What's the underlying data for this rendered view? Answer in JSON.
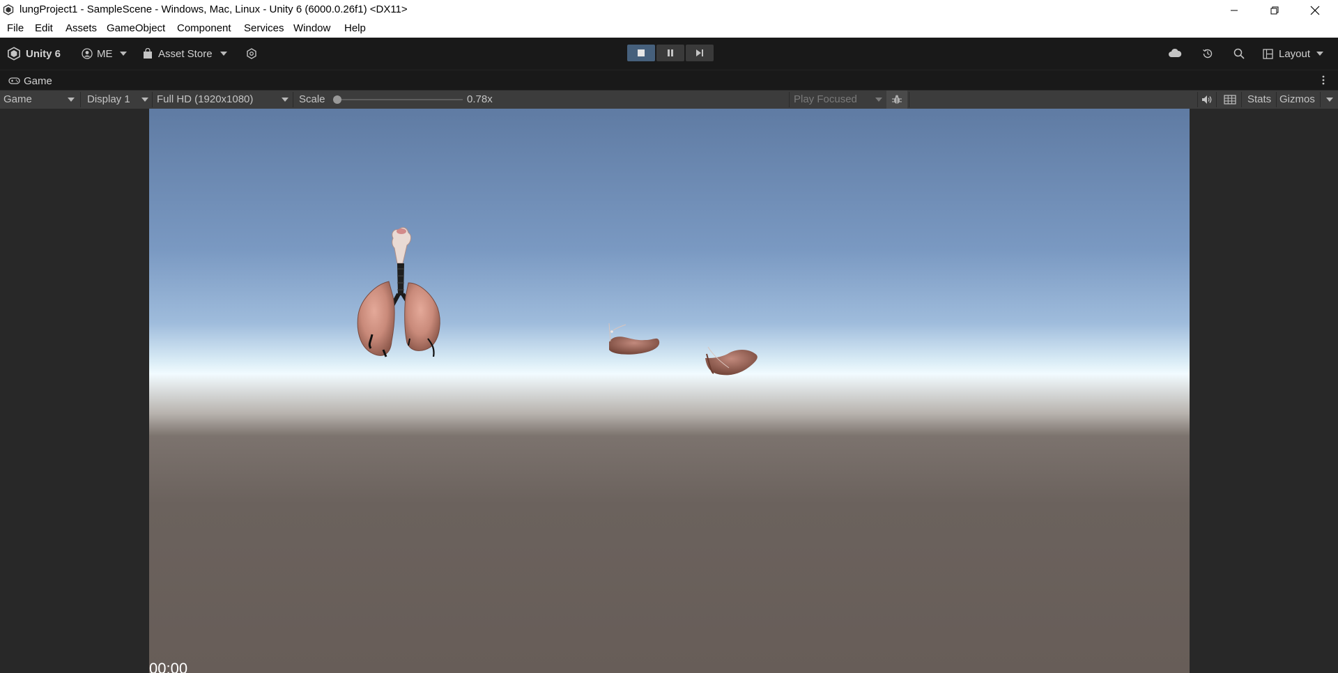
{
  "window": {
    "title": "lungProject1 - SampleScene - Windows, Mac, Linux - Unity 6 (6000.0.26f1) <DX11>",
    "controls": [
      "minimize-icon",
      "restore-icon",
      "close-icon"
    ]
  },
  "menu": {
    "items": [
      "File",
      "Edit",
      "Assets",
      "GameObject",
      "Component",
      "Services",
      "Window",
      "Help"
    ]
  },
  "toolbar": {
    "unity_label": "Unity 6",
    "account_label": "ME",
    "asset_store_label": "Asset Store",
    "layout_label": "Layout",
    "play_state": "playing"
  },
  "tab": {
    "label": "Game"
  },
  "game_controls": {
    "view_mode": "Game",
    "display": "Display 1",
    "resolution": "Full HD (1920x1080)",
    "scale_label": "Scale",
    "scale_value_text": "0.78x",
    "scale_slider_fraction": 0.0,
    "play_focused": "Play Focused",
    "stats_label": "Stats",
    "gizmos_label": "Gizmos"
  },
  "viewport": {
    "overlay_text": "00:00",
    "sky_top_color": "#5f7ba3",
    "horizon_color": "#f2fbff",
    "ground_color": "#6b625d",
    "object_color": "#c98a7a"
  }
}
